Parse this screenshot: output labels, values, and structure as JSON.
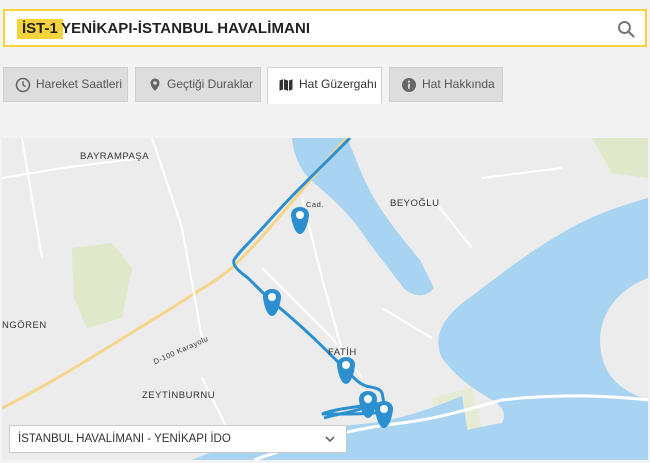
{
  "header": {
    "code": "İST-1",
    "title": "YENİKAPI-İSTANBUL HAVALİMANI",
    "search_icon": "search-icon"
  },
  "tabs": [
    {
      "label": "Hareket Saatleri",
      "icon": "clock-icon",
      "active": false
    },
    {
      "label": "Geçtiği Duraklar",
      "icon": "map-pin-icon",
      "active": false
    },
    {
      "label": "Hat Güzergahı",
      "icon": "map-icon",
      "active": true
    },
    {
      "label": "Hat Hakkında",
      "icon": "info-icon",
      "active": false
    }
  ],
  "map": {
    "labels": {
      "bayrampasa": "BAYRAMPAŞA",
      "beyoglu": "BEYOĞLU",
      "ngoren": "NGÖREN",
      "fatih": "FATİH",
      "zeytinburnu": "ZEYTİNBURNU",
      "d100": "D-100 Karayolu",
      "cad": "Cad."
    },
    "colors": {
      "water": "#a8d4f2",
      "land": "#ececec",
      "route": "#2b8fd0",
      "accent": "#f6d33a"
    }
  },
  "direction": {
    "selected": "İSTANBUL HAVALİMANI - YENİKAPI İDO"
  }
}
